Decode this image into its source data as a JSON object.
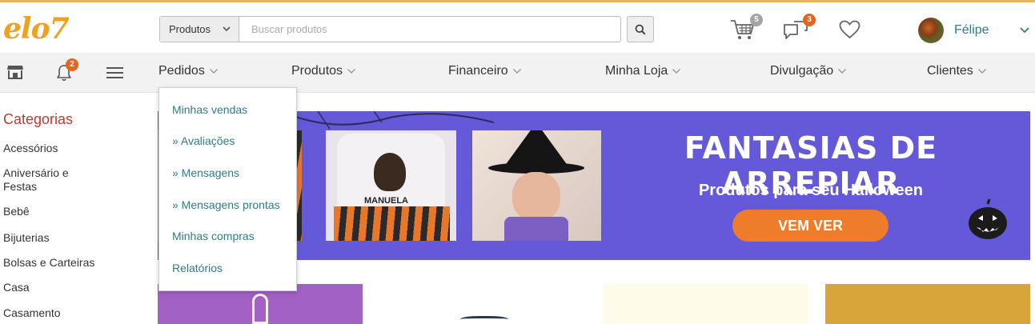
{
  "brand": {
    "logo": "elo7"
  },
  "search": {
    "select_value": "Produtos",
    "placeholder": "Buscar produtos"
  },
  "header": {
    "cart_count": "5",
    "messages_count": "3",
    "user_name": "Félipe"
  },
  "toolbar": {
    "notifications_count": "2"
  },
  "nav": {
    "items": [
      {
        "label": "Pedidos"
      },
      {
        "label": "Produtos"
      },
      {
        "label": "Financeiro"
      },
      {
        "label": "Minha Loja"
      },
      {
        "label": "Divulgação"
      },
      {
        "label": "Clientes"
      }
    ]
  },
  "dropdown": {
    "items": [
      {
        "label": "Minhas vendas"
      },
      {
        "label": "» Avaliações"
      },
      {
        "label": "» Mensagens"
      },
      {
        "label": "» Mensagens prontas"
      },
      {
        "label": "Minhas compras"
      },
      {
        "label": "Relatórios"
      }
    ]
  },
  "sidebar": {
    "title": "Categorias",
    "items": [
      {
        "label": "Acessórios"
      },
      {
        "label": "Aniversário e Festas"
      },
      {
        "label": "Bebê"
      },
      {
        "label": "Bijuterias"
      },
      {
        "label": "Bolsas e Carteiras"
      },
      {
        "label": "Casa"
      },
      {
        "label": "Casamento"
      }
    ]
  },
  "banner": {
    "title": "FANTASIAS DE ARREPIAR",
    "subtitle": "Produtos para seu Halloween",
    "cta": "VEM VER",
    "shirt_name": "MANUELA"
  },
  "colors": {
    "accent_orange": "#f0a11f",
    "teal_link": "#2f7c83",
    "category_red": "#c0392b",
    "banner_purple": "#6459d8",
    "cta_orange": "#ef7c2a"
  }
}
